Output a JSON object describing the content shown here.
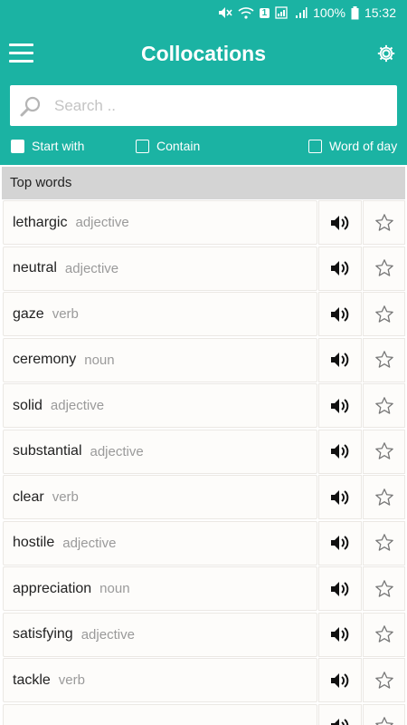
{
  "status_bar": {
    "battery": "100%",
    "time": "15:32",
    "sim_badge": "1"
  },
  "app": {
    "title": "Collocations"
  },
  "search": {
    "placeholder": "Search .."
  },
  "filters": [
    {
      "label": "Start with",
      "checked": true
    },
    {
      "label": "Contain",
      "checked": false
    },
    {
      "label": "Word of day",
      "checked": false
    }
  ],
  "section": {
    "title": "Top words"
  },
  "words": [
    {
      "word": "lethargic",
      "pos": "adjective"
    },
    {
      "word": "neutral",
      "pos": "adjective"
    },
    {
      "word": "gaze",
      "pos": "verb"
    },
    {
      "word": "ceremony",
      "pos": "noun"
    },
    {
      "word": "solid",
      "pos": "adjective"
    },
    {
      "word": "substantial",
      "pos": "adjective"
    },
    {
      "word": "clear",
      "pos": "verb"
    },
    {
      "word": "hostile",
      "pos": "adjective"
    },
    {
      "word": "appreciation",
      "pos": "noun"
    },
    {
      "word": "satisfying",
      "pos": "adjective"
    },
    {
      "word": "tackle",
      "pos": "verb"
    },
    {
      "word": "",
      "pos": ""
    }
  ],
  "colors": {
    "primary": "#1bb3a3",
    "header_bg": "#d4d4d4",
    "pos_text": "#9a9a9a"
  },
  "icons": {
    "menu": "hamburger-icon",
    "settings": "gear-icon",
    "search": "search-icon",
    "audio": "speaker-icon",
    "favorite": "star-outline-icon"
  }
}
